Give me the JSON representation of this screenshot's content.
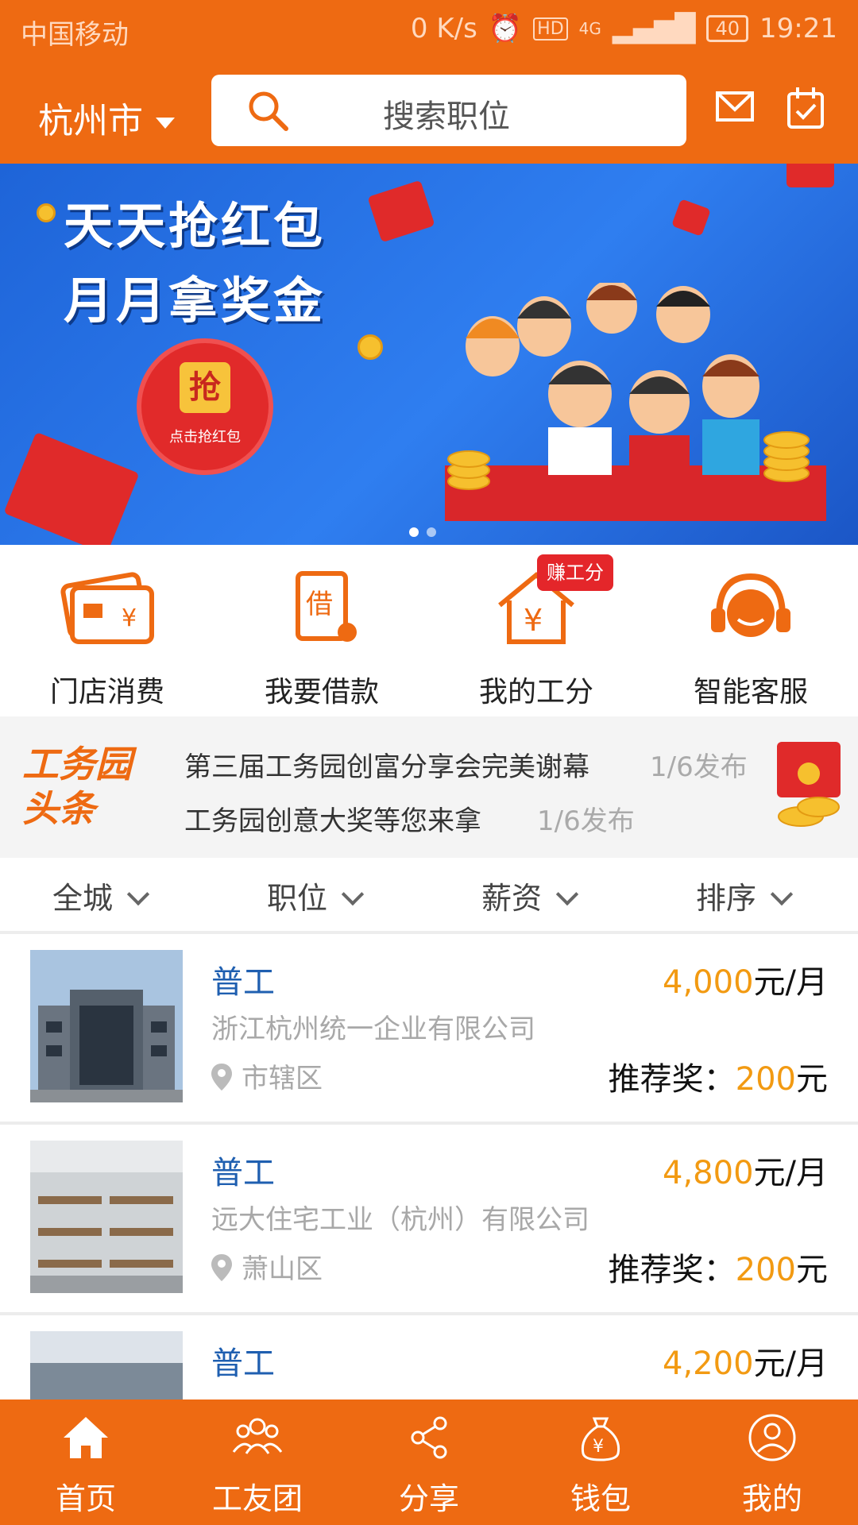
{
  "status_bar": {
    "carrier": "中国移动",
    "speed": "0 K/s",
    "network": "4G",
    "battery": "40",
    "time": "19:21"
  },
  "header": {
    "city": "杭州市",
    "search_placeholder": "搜索职位"
  },
  "banner": {
    "line1": "天天抢红包",
    "line2": "月月拿奖金",
    "button_glyph": "抢",
    "button_label": "点击抢红包",
    "page_index": 1,
    "page_count": 2
  },
  "quick_menu": [
    {
      "label": "门店消费",
      "icon": "card-icon"
    },
    {
      "label": "我要借款",
      "icon": "loan-scroll-icon"
    },
    {
      "label": "我的工分",
      "icon": "house-yen-icon",
      "badge": "赚工分"
    },
    {
      "label": "智能客服",
      "icon": "headset-icon"
    }
  ],
  "news": {
    "logo_line1": "工务园",
    "logo_line2": "头条",
    "items": [
      {
        "text": "第三届工务园创富分享会完美谢幕",
        "date": "1/6发布"
      },
      {
        "text": "工务园创意大奖等您来拿",
        "date": "1/6发布"
      }
    ]
  },
  "filters": [
    "全城",
    "职位",
    "薪资",
    "排序"
  ],
  "jobs": [
    {
      "title": "普工",
      "salary_num": "4,000",
      "salary_unit": "元/月",
      "company": "浙江杭州统一企业有限公司",
      "district": "市辖区",
      "reward_label": "推荐奖：",
      "reward_num": "200",
      "reward_unit": "元"
    },
    {
      "title": "普工",
      "salary_num": "4,800",
      "salary_unit": "元/月",
      "company": "远大住宅工业（杭州）有限公司",
      "district": "萧山区",
      "reward_label": "推荐奖：",
      "reward_num": "200",
      "reward_unit": "元"
    },
    {
      "title": "普工",
      "salary_num": "4,200",
      "salary_unit": "元/月"
    }
  ],
  "tabbar": [
    {
      "label": "首页",
      "icon": "home-icon",
      "active": true
    },
    {
      "label": "工友团",
      "icon": "group-icon"
    },
    {
      "label": "分享",
      "icon": "share-icon"
    },
    {
      "label": "钱包",
      "icon": "wallet-bag-icon"
    },
    {
      "label": "我的",
      "icon": "profile-icon"
    }
  ],
  "colors": {
    "brand": "#ee6a12",
    "title_blue": "#1f5fb0",
    "salary_orange": "#f29a12",
    "badge_red": "#e4262a"
  }
}
